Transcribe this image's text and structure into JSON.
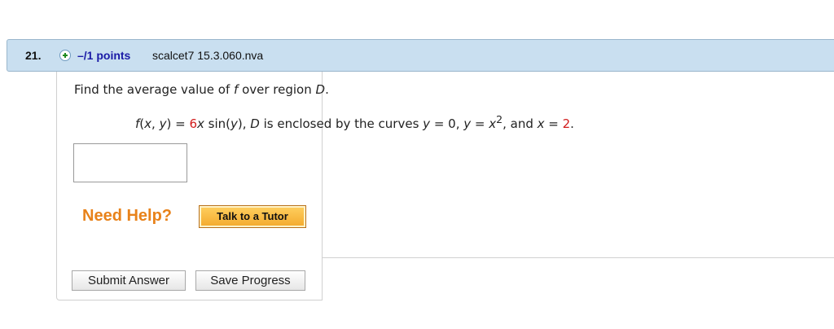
{
  "question": {
    "number": "21.",
    "points": "–/1 points",
    "code": "scalcet7 15.3.060.nva",
    "prompt": {
      "t1": "Find the average value of ",
      "f": "f",
      "t2": " over region ",
      "D": "D",
      "t3": "."
    },
    "formula": {
      "f": "f",
      "open": "(",
      "x": "x",
      "comma": ", ",
      "y": "y",
      "close": ")",
      "eq": " = ",
      "coef": "6",
      "x2": "x",
      "sin": " sin(",
      "y2": "y",
      "sinclose": "),  ",
      "D": "D",
      "t1": " is enclosed by the curves ",
      "y3": "y",
      "eq2": " = 0,  ",
      "y4": "y",
      "eq3": " = ",
      "x3": "x",
      "exp": "2",
      "t2": ",  and ",
      "x4": "x",
      "eq4": " = ",
      "val": "2",
      "period": "."
    },
    "answer_value": ""
  },
  "help": {
    "label": "Need Help?",
    "tutor_button": "Talk to a Tutor"
  },
  "actions": {
    "submit": "Submit Answer",
    "save": "Save Progress"
  },
  "colors": {
    "header_bg": "#c9dff0",
    "points_link": "#1a1aa6",
    "need_help": "#e8821a",
    "highlight": "#d11a1a"
  }
}
